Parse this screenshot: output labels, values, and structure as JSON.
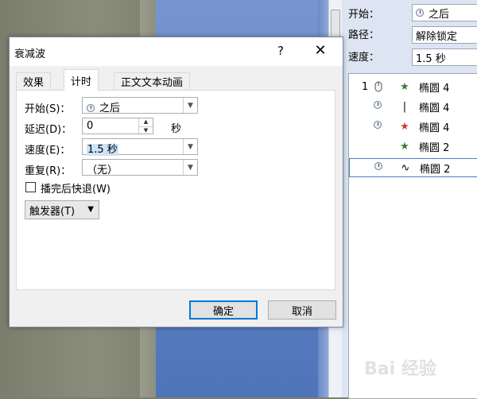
{
  "dialog": {
    "title": "衰减波",
    "help": "?",
    "close": "✕",
    "tabs": [
      {
        "label": "效果"
      },
      {
        "label": "计时"
      },
      {
        "label": "正文文本动画"
      }
    ],
    "start": {
      "label": "开始(S)：",
      "value": "之后"
    },
    "delay": {
      "label": "延迟(D)：",
      "value": "0",
      "unit": "秒"
    },
    "speed": {
      "label": "速度(E)：",
      "value": "1.5 秒"
    },
    "repeat": {
      "label": "重复(R)：",
      "value": "（无）"
    },
    "rewind": {
      "label": "播完后快退(W)",
      "checked": false
    },
    "trigger": {
      "label": "触发器(T)"
    },
    "ok": "确定",
    "cancel": "取消"
  },
  "right_pane": {
    "start_label": "开始：",
    "start_value": "之后",
    "path_label": "路径：",
    "path_value": "解除锁定",
    "speed_label": "速度：",
    "speed_value": "1.5 秒",
    "items": [
      {
        "num": "1",
        "name": "椭圆 4",
        "effect": "★",
        "effect_color": "#3a7a3a",
        "trigger": "mouse-icon"
      },
      {
        "num": "",
        "name": "椭圆 4",
        "effect": "|",
        "effect_color": "#333333",
        "trigger": "clock-icon"
      },
      {
        "num": "",
        "name": "椭圆 4",
        "effect": "★",
        "effect_color": "#d03a2a",
        "trigger": "clock-icon"
      },
      {
        "num": "",
        "name": "椭圆 2",
        "effect": "★",
        "effect_color": "#3a7a3a",
        "trigger": ""
      },
      {
        "num": "",
        "name": "椭圆 2",
        "effect": "∿",
        "effect_color": "#333333",
        "trigger": "clock-icon"
      }
    ]
  },
  "watermark": "Bai 经验"
}
